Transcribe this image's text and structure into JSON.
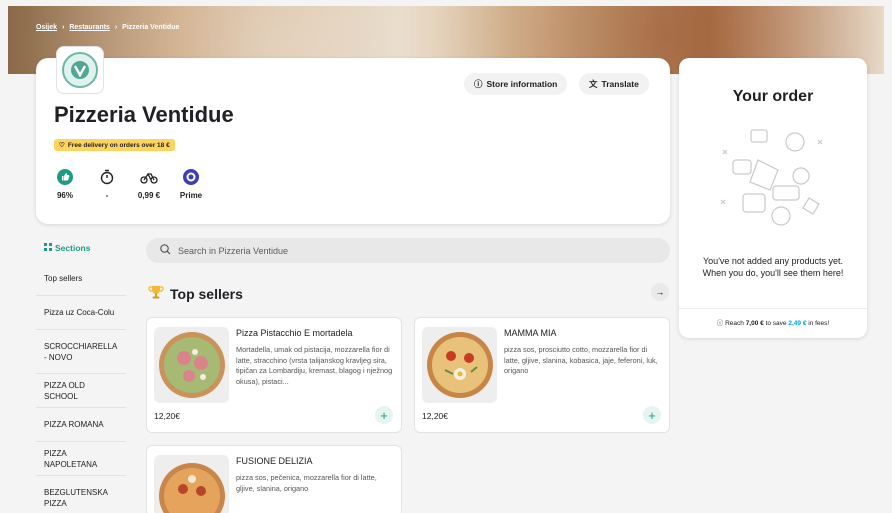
{
  "breadcrumb": [
    "Osijek",
    "Restaurants",
    "Pizzeria Ventidue"
  ],
  "store": {
    "name": "Pizzeria Ventidue",
    "logo_text": "VENTIDUE",
    "delivery_badge": "Free delivery on orders over 18 €",
    "stats": [
      {
        "icon": "thumbs-up-icon",
        "value": "96%"
      },
      {
        "icon": "timer-icon",
        "value": "-"
      },
      {
        "icon": "bike-icon",
        "value": "0,99 €"
      },
      {
        "icon": "prime-icon",
        "value": "Prime"
      }
    ],
    "store_info_label": "Store information",
    "translate_label": "Translate"
  },
  "order": {
    "title": "Your order",
    "empty_text": "You've not added any products yet. When you do, you'll see them here!",
    "reach_prefix": "Reach",
    "reach_amount": "7,00 €",
    "reach_middle": "to save",
    "reach_save": "2,49 €",
    "reach_suffix": "in fees!"
  },
  "sidebar": {
    "title": "Sections",
    "items": [
      {
        "label": "Top sellers"
      },
      {
        "label": "Pizza uz Coca-Colu"
      },
      {
        "label": "SCROCCHIARELLA - NOVO"
      },
      {
        "label": "PIZZA OLD SCHOOL"
      },
      {
        "label": "PIZZA ROMANA"
      },
      {
        "label": "PIZZA NAPOLETANA"
      },
      {
        "label": "BEZGLUTENSKA PIZZA"
      }
    ]
  },
  "search": {
    "placeholder": "Search in Pizzeria Ventidue"
  },
  "section": {
    "title": "Top sellers"
  },
  "products": [
    {
      "name": "Pizza Pistacchio E mortadela",
      "description": "Mortadella, umak od pistacija, mozzarella fior di latte, stracchino (vrsta talijanskog kravljeg sira, tipičan za Lombardiju, kremast, blagog i nježnog okusa), pistaci...",
      "price": "12,20€"
    },
    {
      "name": "MAMMA MIA",
      "description": "pizza sos, prosciutto cotto, mozzarella fior di latte, gljive, slanina, kobasica, jaje, feferoni, luk, origano",
      "price": "12,20€"
    },
    {
      "name": "FUSIONE DELIZIA",
      "description": "pizza sos, pečenica, mozzarella fior di latte, gljive, slanina, origano",
      "price": ""
    }
  ],
  "colors": {
    "accent": "#1d9a84",
    "badge": "#fed45c",
    "save": "#009de0"
  }
}
